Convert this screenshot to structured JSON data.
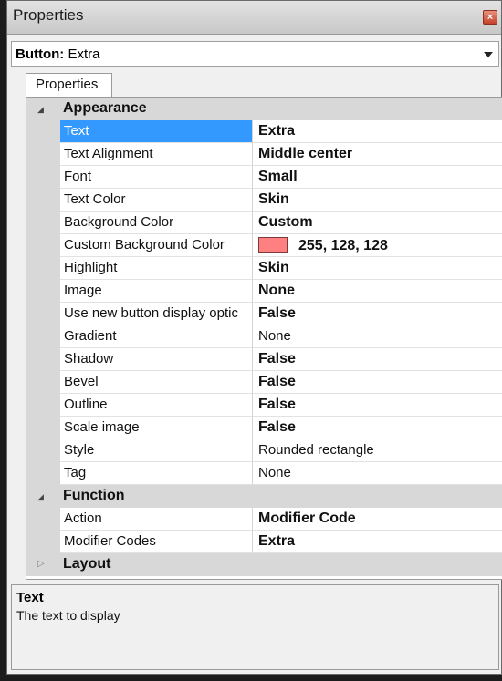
{
  "window": {
    "title": "Properties",
    "close_icon": "close-icon"
  },
  "selector": {
    "type_label": "Button:",
    "value": "Extra"
  },
  "tab": {
    "label": "Properties"
  },
  "colors": {
    "selected_row": "#3399ff",
    "swatch": "#ff8080",
    "category_bg": "#d8d8d8"
  },
  "categories": {
    "appearance": {
      "label": "Appearance",
      "expanded": true,
      "rows": [
        {
          "name": "Text",
          "value": "Extra"
        },
        {
          "name": "Text Alignment",
          "value": "Middle center"
        },
        {
          "name": "Font",
          "value": "Small"
        },
        {
          "name": "Text Color",
          "value": "Skin"
        },
        {
          "name": "Background Color",
          "value": "Custom"
        },
        {
          "name": "Custom Background Color",
          "value": "255, 128, 128"
        },
        {
          "name": "Highlight",
          "value": "Skin"
        },
        {
          "name": "Image",
          "value": "None"
        },
        {
          "name": "Use new button display optic",
          "value": "False"
        },
        {
          "name": "Gradient",
          "value": "None"
        },
        {
          "name": "Shadow",
          "value": "False"
        },
        {
          "name": "Bevel",
          "value": "False"
        },
        {
          "name": "Outline",
          "value": "False"
        },
        {
          "name": "Scale image",
          "value": "False"
        },
        {
          "name": "Style",
          "value": "Rounded rectangle"
        },
        {
          "name": "Tag",
          "value": "None"
        }
      ]
    },
    "function": {
      "label": "Function",
      "expanded": true,
      "rows": [
        {
          "name": "Action",
          "value": "Modifier Code"
        },
        {
          "name": "Modifier Codes",
          "value": "Extra"
        }
      ]
    },
    "layout": {
      "label": "Layout",
      "expanded": false
    }
  },
  "description": {
    "title": "Text",
    "text": "The text to display"
  }
}
